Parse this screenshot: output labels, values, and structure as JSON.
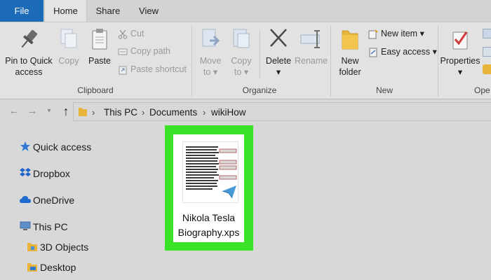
{
  "tabs": {
    "file": "File",
    "home": "Home",
    "share": "Share",
    "view": "View"
  },
  "ribbon": {
    "clipboard": {
      "pin_line1": "Pin to Quick",
      "pin_line2": "access",
      "copy": "Copy",
      "paste": "Paste",
      "cut": "Cut",
      "copy_path": "Copy path",
      "paste_shortcut": "Paste shortcut",
      "group_label": "Clipboard"
    },
    "organize": {
      "move_to": "Move",
      "move_to_2": "to",
      "copy_to": "Copy",
      "copy_to_2": "to",
      "delete": "Delete",
      "rename": "Rename",
      "group_label": "Organize"
    },
    "new": {
      "new_folder_1": "New",
      "new_folder_2": "folder",
      "new_item": "New item",
      "easy_access": "Easy access",
      "group_label": "New"
    },
    "open": {
      "properties": "Properties",
      "group_label": "Ope"
    }
  },
  "address": {
    "crumbs": [
      "This PC",
      "Documents",
      "wikiHow"
    ]
  },
  "nav": {
    "items": [
      "Quick access",
      "Dropbox",
      "OneDrive",
      "This PC",
      "3D Objects",
      "Desktop"
    ]
  },
  "file": {
    "name_line1": "Nikola Tesla",
    "name_line2": "Biography.xps"
  },
  "colors": {
    "file_tab": "#1c6bb8",
    "selection": "#3ae328",
    "folder": "#e8b53a"
  },
  "icons": {
    "pin": "pin-icon",
    "copy": "copy-icon",
    "paste": "clipboard-icon",
    "cut": "scissors-icon",
    "delete": "x-icon",
    "folder": "folder-icon",
    "properties": "checkmark-icon"
  }
}
